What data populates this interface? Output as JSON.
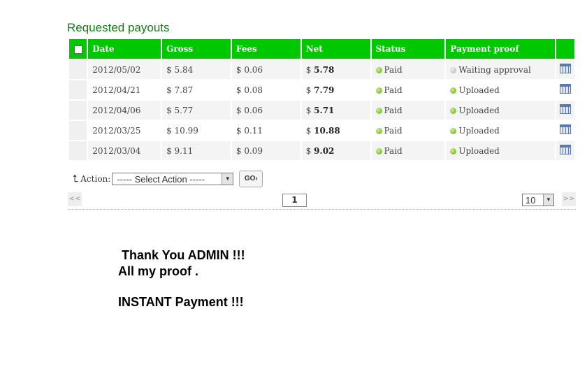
{
  "page_title": "Requested payouts",
  "columns": [
    "Date",
    "Gross",
    "Fees",
    "Net",
    "Status",
    "Payment proof"
  ],
  "rows": [
    {
      "date": "2012/05/02",
      "gross": "$ 5.84",
      "fees": "$ 0.06",
      "net_prefix": "$",
      "net": "5.78",
      "status": "Paid",
      "status_color": "green",
      "proof": "Waiting approval",
      "proof_color": "grey"
    },
    {
      "date": "2012/04/21",
      "gross": "$ 7.87",
      "fees": "$ 0.08",
      "net_prefix": "$",
      "net": "7.79",
      "status": "Paid",
      "status_color": "green",
      "proof": "Uploaded",
      "proof_color": "green"
    },
    {
      "date": "2012/04/06",
      "gross": "$ 5.77",
      "fees": "$ 0.06",
      "net_prefix": "$",
      "net": "5.71",
      "status": "Paid",
      "status_color": "green",
      "proof": "Uploaded",
      "proof_color": "green"
    },
    {
      "date": "2012/03/25",
      "gross": "$ 10.99",
      "fees": "$ 0.11",
      "net_prefix": "$",
      "net": "10.88",
      "status": "Paid",
      "status_color": "green",
      "proof": "Uploaded",
      "proof_color": "green"
    },
    {
      "date": "2012/03/04",
      "gross": "$ 9.11",
      "fees": "$ 0.09",
      "net_prefix": "$",
      "net": "9.02",
      "status": "Paid",
      "status_color": "green",
      "proof": "Uploaded",
      "proof_color": "green"
    }
  ],
  "action": {
    "label": "Action:",
    "select_value": "----- Select Action -----",
    "go_label": "GO›"
  },
  "pager": {
    "prev": "<<",
    "next": ">>",
    "current_page": "1",
    "per_page": "10"
  },
  "message": {
    "line1": "Thank You ADMIN !!!",
    "line2": "All my proof .",
    "line3": "INSTANT Payment !!!"
  },
  "icons": {
    "row_action": "calendar-icon",
    "action_arrow": "turn-up-arrow-icon"
  },
  "colors": {
    "header_bg": "#00c800",
    "title": "#1a7a1a"
  }
}
